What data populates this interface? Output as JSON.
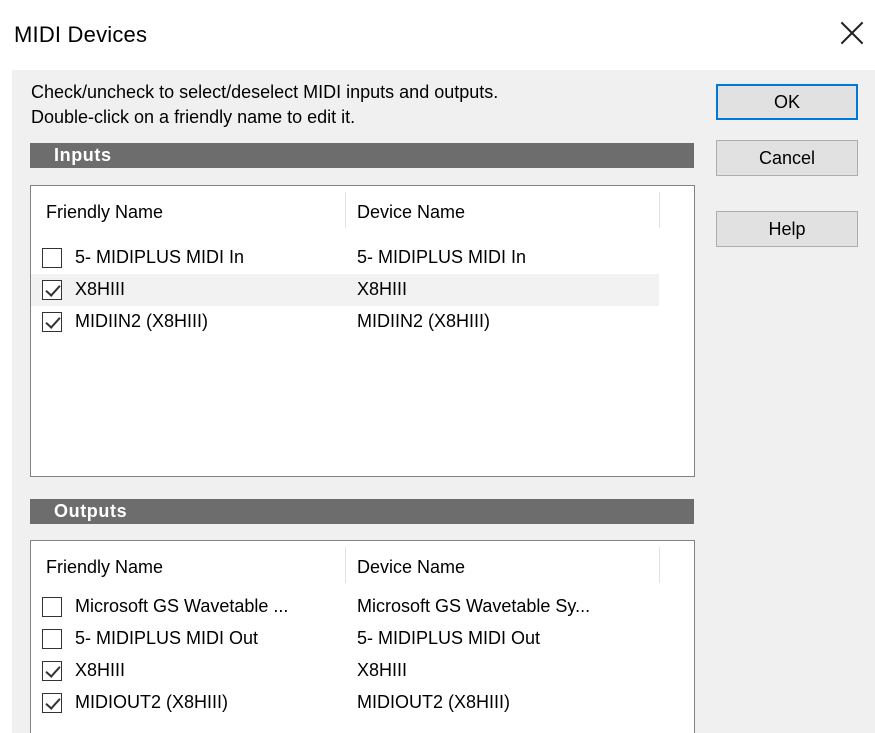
{
  "window": {
    "title": "MIDI Devices",
    "close_icon": "close-icon"
  },
  "instructions": {
    "line1": "Check/uncheck to select/deselect MIDI inputs and outputs.",
    "line2": "Double-click on a friendly name to edit it."
  },
  "buttons": {
    "ok": "OK",
    "cancel": "Cancel",
    "help": "Help"
  },
  "inputs": {
    "title": "Inputs",
    "columns": {
      "friendly": "Friendly Name",
      "device": "Device Name"
    },
    "rows": [
      {
        "checked": false,
        "friendly": "5- MIDIPLUS MIDI In",
        "device": "5- MIDIPLUS MIDI In"
      },
      {
        "checked": true,
        "friendly": "X8HIII",
        "device": "X8HIII"
      },
      {
        "checked": true,
        "friendly": "MIDIIN2 (X8HIII)",
        "device": "MIDIIN2 (X8HIII)"
      }
    ]
  },
  "outputs": {
    "title": "Outputs",
    "columns": {
      "friendly": "Friendly Name",
      "device": "Device Name"
    },
    "rows": [
      {
        "checked": false,
        "friendly": "Microsoft GS Wavetable ...",
        "device": "Microsoft GS Wavetable Sy..."
      },
      {
        "checked": false,
        "friendly": "5- MIDIPLUS MIDI Out",
        "device": "5- MIDIPLUS MIDI Out"
      },
      {
        "checked": true,
        "friendly": "X8HIII",
        "device": "X8HIII"
      },
      {
        "checked": true,
        "friendly": "MIDIOUT2 (X8HIII)",
        "device": "MIDIOUT2 (X8HIII)"
      }
    ]
  },
  "colors": {
    "section_bar": "#6d6d6d",
    "default_button_border": "#0078d7",
    "dialog_bg": "#f0f0f0"
  }
}
